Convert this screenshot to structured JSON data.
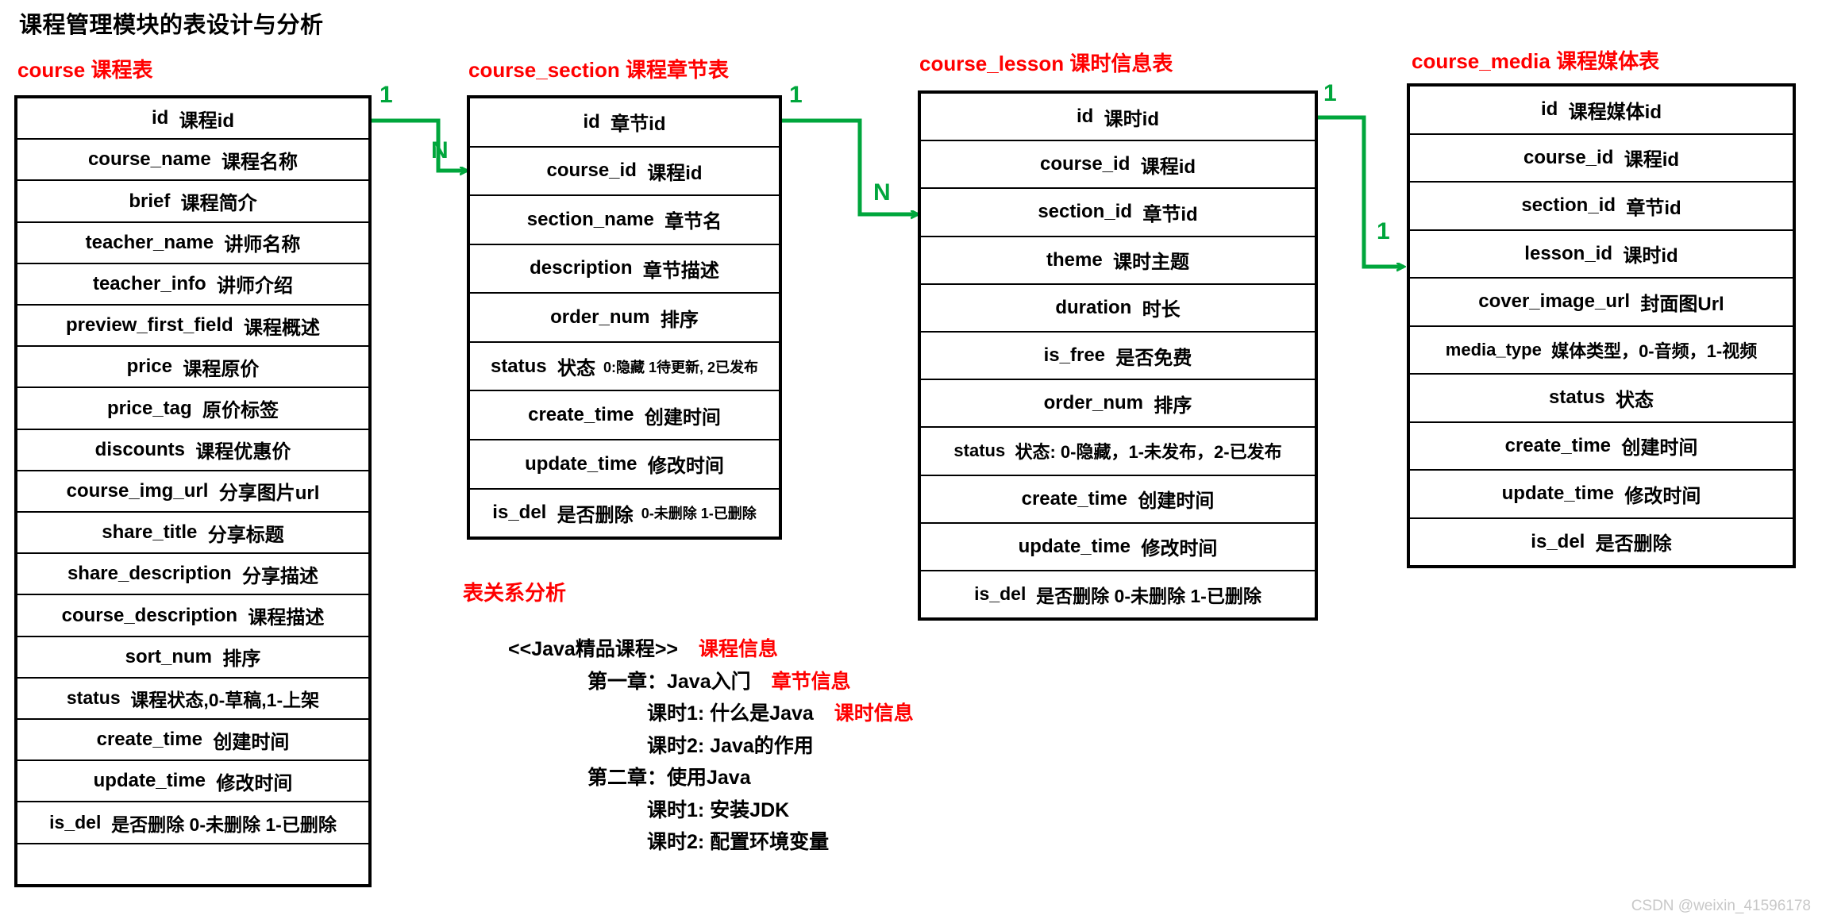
{
  "page": {
    "title": "课程管理模块的表设计与分析",
    "watermark": "CSDN @weixin_41596178"
  },
  "colors": {
    "title_black": "#000000",
    "table_title_red": "#ff0000",
    "connector_green": "#00a63c",
    "border_black": "#000000",
    "watermark_gray": "#c8c8c8"
  },
  "tables": [
    {
      "id": "course",
      "title": "course 课程表",
      "rows": [
        {
          "name": "id",
          "note": "课程id"
        },
        {
          "name": "course_name",
          "note": "课程名称"
        },
        {
          "name": "brief",
          "note": "课程简介"
        },
        {
          "name": "teacher_name",
          "note": "讲师名称"
        },
        {
          "name": "teacher_info",
          "note": "讲师介绍"
        },
        {
          "name": "preview_first_field",
          "note": "课程概述"
        },
        {
          "name": "price",
          "note": "课程原价"
        },
        {
          "name": "price_tag",
          "note": "原价标签"
        },
        {
          "name": "discounts",
          "note": "课程优惠价"
        },
        {
          "name": "course_img_url",
          "note": "分享图片url"
        },
        {
          "name": "share_title",
          "note": "分享标题"
        },
        {
          "name": "share_description",
          "note": "分享描述"
        },
        {
          "name": "course_description",
          "note": "课程描述"
        },
        {
          "name": "sort_num",
          "note": "排序"
        },
        {
          "name": "status",
          "note": "课程状态,0-草稿,1-上架"
        },
        {
          "name": "create_time",
          "note": "创建时间"
        },
        {
          "name": "update_time",
          "note": "修改时间"
        },
        {
          "name": "is_del",
          "note": "是否删除 0-未删除 1-已删除"
        },
        {
          "name": "",
          "note": ""
        }
      ]
    },
    {
      "id": "course_section",
      "title": "course_section 课程章节表",
      "rows": [
        {
          "name": "id",
          "note": "章节id"
        },
        {
          "name": "course_id",
          "note": "课程id"
        },
        {
          "name": "section_name",
          "note": "章节名"
        },
        {
          "name": "description",
          "note": "章节描述"
        },
        {
          "name": "order_num",
          "note": "排序"
        },
        {
          "name": "status",
          "note": "状态",
          "note2": "0:隐藏 1待更新, 2已发布"
        },
        {
          "name": "create_time",
          "note": "创建时间"
        },
        {
          "name": "update_time",
          "note": "修改时间"
        },
        {
          "name": "is_del",
          "note": "是否删除",
          "note2": "0-未删除 1-已删除"
        }
      ]
    },
    {
      "id": "course_lesson",
      "title": "course_lesson 课时信息表",
      "rows": [
        {
          "name": "id",
          "note": "课时id"
        },
        {
          "name": "course_id",
          "note": "课程id"
        },
        {
          "name": "section_id",
          "note": "章节id"
        },
        {
          "name": "theme",
          "note": "课时主题"
        },
        {
          "name": "duration",
          "note": "时长"
        },
        {
          "name": "is_free",
          "note": "是否免费"
        },
        {
          "name": "order_num",
          "note": "排序"
        },
        {
          "name": "status",
          "note": "状态: 0-隐藏，1-未发布，2-已发布"
        },
        {
          "name": "create_time",
          "note": "创建时间"
        },
        {
          "name": "update_time",
          "note": "修改时间"
        },
        {
          "name": "is_del",
          "note": "是否删除 0-未删除 1-已删除"
        }
      ]
    },
    {
      "id": "course_media",
      "title": "course_media 课程媒体表",
      "rows": [
        {
          "name": "id",
          "note": "课程媒体id"
        },
        {
          "name": "course_id",
          "note": "课程id"
        },
        {
          "name": "section_id",
          "note": "章节id"
        },
        {
          "name": "lesson_id",
          "note": "课时id"
        },
        {
          "name": "cover_image_url",
          "note": "封面图Url"
        },
        {
          "name": "media_type",
          "note": "媒体类型，0-音频，1-视频"
        },
        {
          "name": "status",
          "note": "状态"
        },
        {
          "name": "create_time",
          "note": "创建时间"
        },
        {
          "name": "update_time",
          "note": "修改时间"
        },
        {
          "name": "is_del",
          "note": "是否删除"
        }
      ]
    }
  ],
  "relations": [
    {
      "from": "course",
      "to": "course_section",
      "from_card": "1",
      "to_card": "N"
    },
    {
      "from": "course_section",
      "to": "course_lesson",
      "from_card": "1",
      "to_card": "N"
    },
    {
      "from": "course_lesson",
      "to": "course_media",
      "from_card": "1",
      "to_card": "1"
    }
  ],
  "analysis": {
    "heading": "表关系分析",
    "lines": [
      {
        "text": "<<Java精品课程>>",
        "tag": "课程信息",
        "indent": 0
      },
      {
        "text": "第一章：Java入门",
        "tag": "章节信息",
        "indent": 1
      },
      {
        "text": "课时1: 什么是Java",
        "tag": "课时信息",
        "indent": 2
      },
      {
        "text": "课时2: Java的作用",
        "tag": "",
        "indent": 2
      },
      {
        "text": "第二章：使用Java",
        "tag": "",
        "indent": 1
      },
      {
        "text": "课时1: 安装JDK",
        "tag": "",
        "indent": 2
      },
      {
        "text": "课时2: 配置环境变量",
        "tag": "",
        "indent": 2
      }
    ]
  }
}
